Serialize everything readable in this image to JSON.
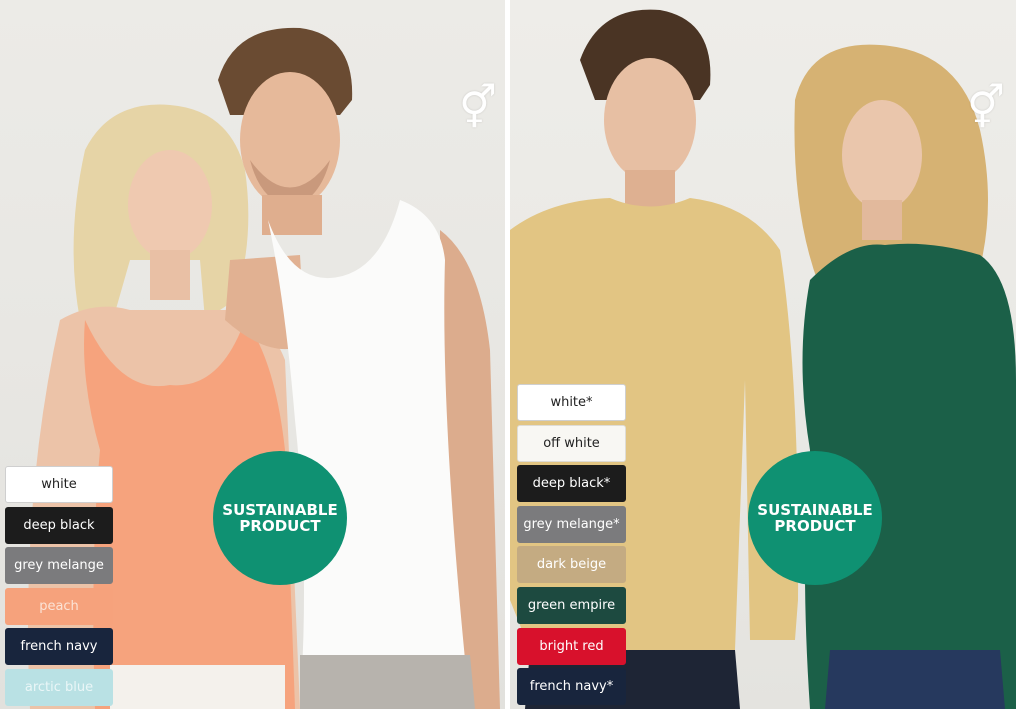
{
  "left_panel": {
    "badge": {
      "line1": "SUSTAINABLE",
      "line2": "PRODUCT"
    },
    "gender_icon": "unisex-symbol-icon",
    "colors": [
      {
        "label": "white",
        "bg": "#ffffff",
        "fg": "#222222",
        "border": "#cfcfcf"
      },
      {
        "label": "deep black",
        "bg": "#1c1c1c",
        "fg": "#ffffff",
        "border": "#1c1c1c"
      },
      {
        "label": "grey melange",
        "bg": "#7b7b7d",
        "fg": "#ffffff",
        "border": "#7b7b7d"
      },
      {
        "label": "peach",
        "bg": "#f6a27c",
        "fg": "#fbe3d6",
        "border": "#f6a27c"
      },
      {
        "label": "french navy",
        "bg": "#18253d",
        "fg": "#ffffff",
        "border": "#18253d"
      },
      {
        "label": "arctic blue",
        "bg": "#b9e1e4",
        "fg": "#eaf6f7",
        "border": "#b9e1e4"
      }
    ]
  },
  "right_panel": {
    "badge": {
      "line1": "SUSTAINABLE",
      "line2": "PRODUCT"
    },
    "gender_icon": "unisex-symbol-icon",
    "colors": [
      {
        "label": "white*",
        "bg": "#ffffff",
        "fg": "#222222",
        "border": "#cfcfcf"
      },
      {
        "label": "off white",
        "bg": "#f8f7f3",
        "fg": "#222222",
        "border": "#dedcd6"
      },
      {
        "label": "deep black*",
        "bg": "#1c1c1c",
        "fg": "#ffffff",
        "border": "#1c1c1c"
      },
      {
        "label": "grey melange*",
        "bg": "#7b7b7d",
        "fg": "#ffffff",
        "border": "#7b7b7d"
      },
      {
        "label": "dark beige",
        "bg": "#c4ab82",
        "fg": "#ffffff",
        "border": "#c4ab82"
      },
      {
        "label": "green empire",
        "bg": "#1d4a40",
        "fg": "#ffffff",
        "border": "#1d4a40"
      },
      {
        "label": "bright red",
        "bg": "#d8112c",
        "fg": "#ffffff",
        "border": "#d8112c"
      },
      {
        "label": "french navy*",
        "bg": "#18253d",
        "fg": "#ffffff",
        "border": "#18253d"
      }
    ]
  }
}
